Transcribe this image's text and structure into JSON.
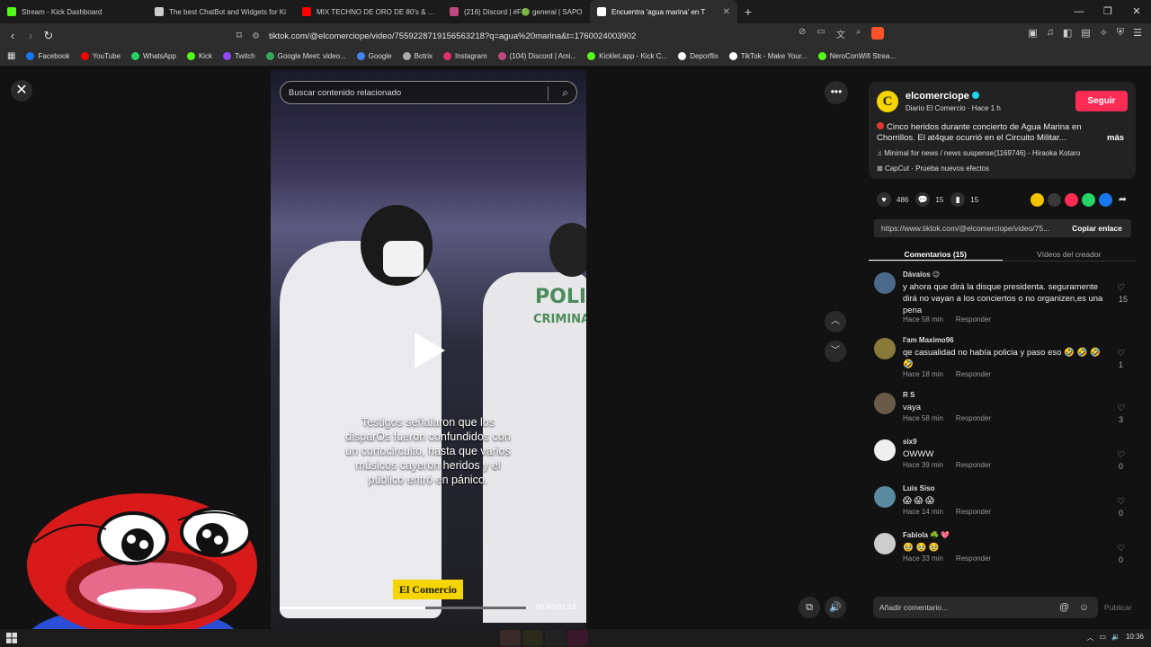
{
  "browser": {
    "tabs": [
      {
        "label": "Stream - Kick Dashboard",
        "color": "#53fc18"
      },
      {
        "label": "The best ChatBot and Widgets for Ki",
        "color": "#cccccc"
      },
      {
        "label": "MIX TECHNO DE ORO DE 80's & 90's",
        "color": "#ff0000"
      },
      {
        "label": "(216) Discord | #F🟢 general | SAPO",
        "color": "#c0487e"
      },
      {
        "label": "Encuentra 'agua marina' en T",
        "color": "#ffffff",
        "active": true
      }
    ],
    "url": "tiktok.com/@elcomerciope/video/7559228719156563218?q=agua%20marina&t=1760024003902",
    "bookmarks": [
      {
        "label": "Facebook",
        "color": "#1877f2"
      },
      {
        "label": "YouTube",
        "color": "#ff0000"
      },
      {
        "label": "WhatsApp",
        "color": "#25d366"
      },
      {
        "label": "Kick",
        "color": "#53fc18"
      },
      {
        "label": "Twitch",
        "color": "#9146ff"
      },
      {
        "label": "Google Meet: video...",
        "color": "#34a853"
      },
      {
        "label": "Google",
        "color": "#4285f4"
      },
      {
        "label": "Botrix",
        "color": "#aaaaaa"
      },
      {
        "label": "Instagram",
        "color": "#e1306c"
      },
      {
        "label": "(104) Discord | Ami...",
        "color": "#c0487e"
      },
      {
        "label": "Kicklet.app - Kick C...",
        "color": "#53fc18"
      },
      {
        "label": "Deporflix",
        "color": "#ffffff"
      },
      {
        "label": "TikTok - Make Your...",
        "color": "#ffffff"
      },
      {
        "label": "NeroConWifi Strea...",
        "color": "#53fc18"
      }
    ]
  },
  "video": {
    "search_placeholder": "Buscar contenido relacionado",
    "caption": "Testigos señalaron que los disparOs fueron confundidos con un cortocircuito, hasta que varios músicos cayeron heridos y el público entró en pánico.",
    "scene_text_1": "POLI",
    "scene_text_2": "CRIMINAL",
    "watermark": "El Comercio",
    "time": "00:43/01:13",
    "progress": 0.59
  },
  "post": {
    "username": "elcomerciope",
    "subtitle": "Diario El Comercio · Hace 1 h",
    "follow_label": "Seguir",
    "description": "Cinco heridos durante concierto de Agua Marina en Chorrillos. El at4que ocurrió en el Circuito Militar...",
    "more_label": "más",
    "music": "Minimal for news / news suspense(1169746) - Hiraoka Kotaro",
    "capcut": "CapCut · Prueba nuevos efectos",
    "likes": "486",
    "comments_count": "15",
    "saves": "15",
    "link": "https://www.tiktok.com/@elcomerciope/video/75...",
    "copy_label": "Copiar enlace",
    "tab_comments": "Comentarios (15)",
    "tab_creator": "Vídeos del creador"
  },
  "comments": [
    {
      "name": "Dávalos 😉",
      "text": "y ahora que dirá la disque presidenta. seguramente dirá no vayan a los conciertos o no organizen,es una pena",
      "time": "Hace 58 min",
      "reply": "Responder",
      "likes": "15",
      "avatar": "#4a6a8a"
    },
    {
      "name": "I'am Maximo96",
      "text": "qe casualidad no había policia y paso eso 🤣 🤣 🤣 🤣",
      "time": "Hace 18 min",
      "reply": "Responder",
      "likes": "1",
      "avatar": "#8a7a3a"
    },
    {
      "name": "R S",
      "text": "vaya",
      "time": "Hace 58 min",
      "reply": "Responder",
      "likes": "3",
      "avatar": "#6a5a4a"
    },
    {
      "name": "six9",
      "text": "OWWW",
      "time": "Hace 39 min",
      "reply": "Responder",
      "likes": "0",
      "avatar": "#eeeeee"
    },
    {
      "name": "Luis Siso",
      "text": "😱 😱 😱",
      "time": "Hace 14 min",
      "reply": "Responder",
      "likes": "0",
      "avatar": "#5a8aa0"
    },
    {
      "name": "Fabiola ☘️ 💖",
      "text": "🥹 🥹 🥹",
      "time": "Hace 33 min",
      "reply": "Responder",
      "likes": "0",
      "avatar": "#cccccc"
    }
  ],
  "comment_input_placeholder": "Añadir comentario...",
  "publish_label": "Publicar",
  "clock": "10:36"
}
